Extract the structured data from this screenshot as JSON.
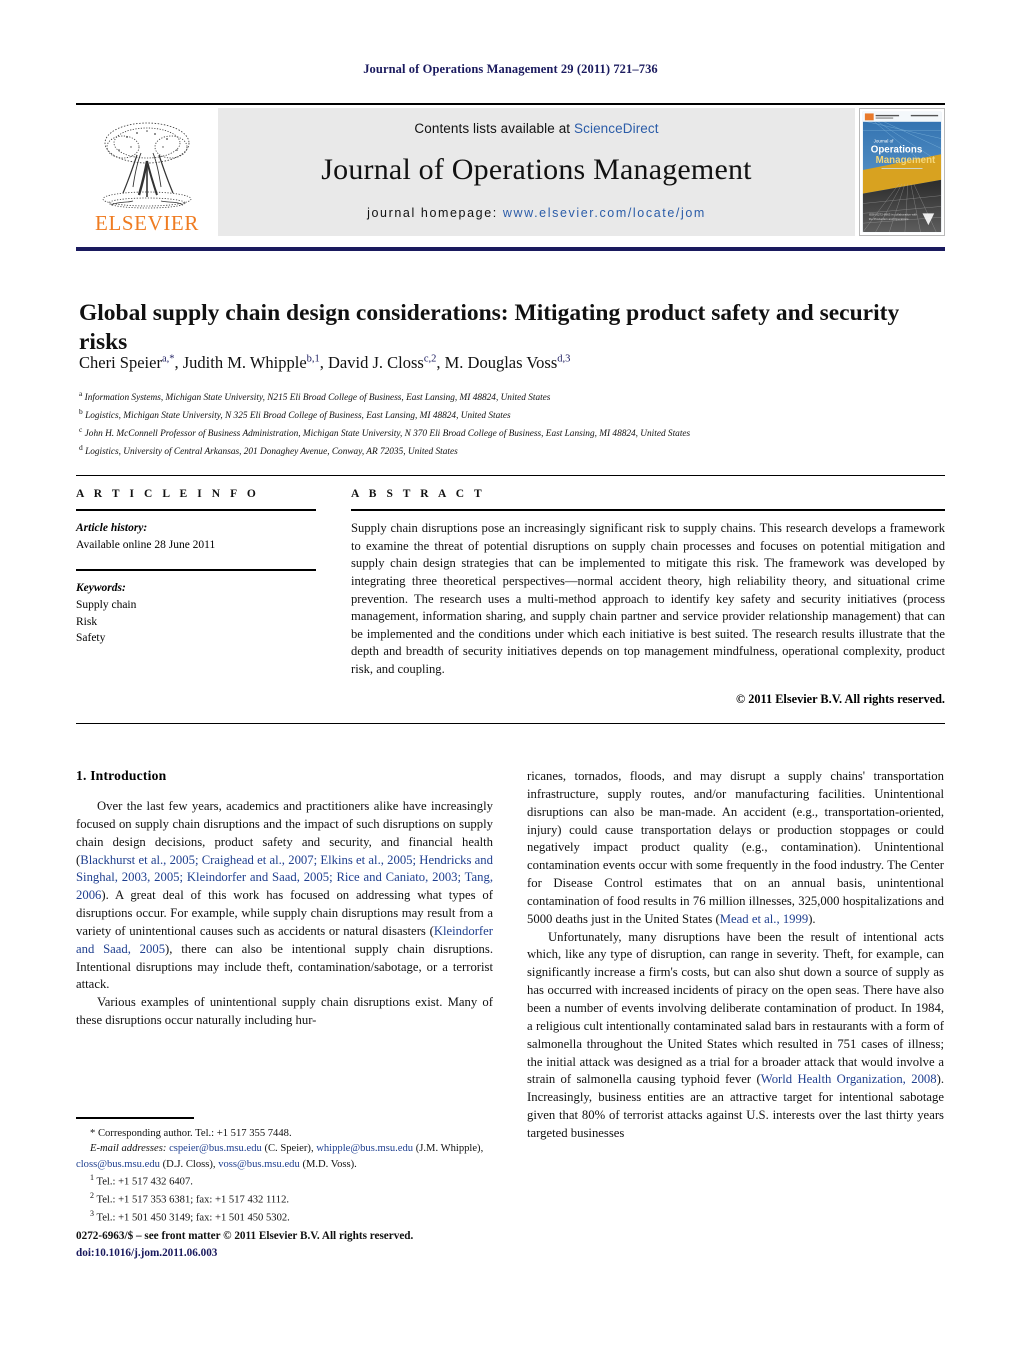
{
  "running_head": "Journal of Operations Management 29 (2011) 721–736",
  "masthead": {
    "publisher_logo_name": "elsevier-tree-logo",
    "publisher_name": "ELSEVIER",
    "contents_prefix": "Contents lists available at ",
    "contents_link": "ScienceDirect",
    "journal_title": "Journal of Operations Management",
    "homepage_prefix": "journal homepage: ",
    "homepage_url": "www.elsevier.com/locate/jom",
    "cover_line1": "Journal of",
    "cover_line2": "Operations",
    "cover_line3": "Management"
  },
  "article": {
    "title": "Global supply chain design considerations: Mitigating product safety and security risks",
    "authors_html": "Cheri Speier<sup>a,*</sup>, Judith M. Whipple<sup>b,1</sup>, David J. Closs<sup>c,2</sup>, M. Douglas Voss<sup>d,3</sup>",
    "affiliations": [
      {
        "marker": "a",
        "text": "Information Systems, Michigan State University, N215 Eli Broad College of Business, East Lansing, MI 48824, United States"
      },
      {
        "marker": "b",
        "text": "Logistics, Michigan State University, N 325 Eli Broad College of Business, East Lansing, MI 48824, United States"
      },
      {
        "marker": "c",
        "text": "John H. McConnell Professor of Business Administration, Michigan State University, N 370 Eli Broad College of Business, East Lansing, MI 48824, United States"
      },
      {
        "marker": "d",
        "text": "Logistics, University of Central Arkansas, 201 Donaghey Avenue, Conway, AR 72035, United States"
      }
    ]
  },
  "article_info": {
    "heading": "A R T I C L E    I N F O",
    "history_label": "Article history:",
    "history_value": "Available online 28 June 2011",
    "keywords_label": "Keywords:",
    "keywords": [
      "Supply chain",
      "Risk",
      "Safety"
    ]
  },
  "abstract": {
    "heading": "A B S T R A C T",
    "text": "Supply chain disruptions pose an increasingly significant risk to supply chains. This research develops a framework to examine the threat of potential disruptions on supply chain processes and focuses on potential mitigation and supply chain design strategies that can be implemented to mitigate this risk. The framework was developed by integrating three theoretical perspectives—normal accident theory, high reliability theory, and situational crime prevention. The research uses a multi-method approach to identify key safety and security initiatives (process management, information sharing, and supply chain partner and service provider relationship management) that can be implemented and the conditions under which each initiative is best suited. The research results illustrate that the depth and breadth of security initiatives depends on top management mindfulness, operational complexity, product risk, and coupling.",
    "copyright": "© 2011 Elsevier B.V. All rights reserved."
  },
  "body": {
    "section_number_title": "1.  Introduction",
    "left_paragraphs": [
      "Over the last few years, academics and practitioners alike have increasingly focused on supply chain disruptions and the impact of such disruptions on supply chain design decisions, product safety and security, and financial health (Blackhurst et al., 2005; Craighead et al., 2007; Elkins et al., 2005; Hendricks and Singhal, 2003, 2005; Kleindorfer and Saad, 2005; Rice and Caniato, 2003; Tang, 2006). A great deal of this work has focused on addressing what types of disruptions occur. For example, while supply chain disruptions may result from a variety of unintentional causes such as accidents or natural disasters (Kleindorfer and Saad, 2005), there can also be intentional supply chain disruptions. Intentional disruptions may include theft, contamination/sabotage, or a terrorist attack.",
      "Various examples of unintentional supply chain disruptions exist. Many of these disruptions occur naturally including hur-"
    ],
    "right_paragraphs": [
      "ricanes, tornados, floods, and may disrupt a supply chains' transportation infrastructure, supply routes, and/or manufacturing facilities. Unintentional disruptions can also be man-made. An accident (e.g., transportation-oriented, injury) could cause transportation delays or production stoppages or could negatively impact product quality (e.g., contamination). Unintentional contamination events occur with some frequently in the food industry. The Center for Disease Control estimates that on an annual basis, unintentional contamination of food results in 76 million illnesses, 325,000 hospitalizations and 5000 deaths just in the United States (Mead et al., 1999).",
      "Unfortunately, many disruptions have been the result of intentional acts which, like any type of disruption, can range in severity. Theft, for example, can significantly increase a firm's costs, but can also shut down a source of supply as has occurred with increased incidents of piracy on the open seas. There have also been a number of events involving deliberate contamination of product. In 1984, a religious cult intentionally contaminated salad bars in restaurants with a form of salmonella throughout the United States which resulted in 751 cases of illness; the initial attack was designed as a trial for a broader attack that would involve a strain of salmonella causing typhoid fever (World Health Organization, 2008). Increasingly, business entities are an attractive target for intentional sabotage given that 80% of terrorist attacks against U.S. interests over the last thirty years targeted businesses"
    ]
  },
  "footnotes": {
    "corresponding": "* Corresponding author. Tel.: +1 517 355 7448.",
    "email_label": "E-mail addresses:",
    "emails": [
      {
        "address": "cspeier@bus.msu.edu",
        "person": "(C. Speier)"
      },
      {
        "address": "whipple@bus.msu.edu",
        "person": "(J.M. Whipple)"
      },
      {
        "address": "closs@bus.msu.edu",
        "person": "(D.J. Closs)"
      },
      {
        "address": "voss@bus.msu.edu",
        "person": "(M.D. Voss)."
      }
    ],
    "numbered": [
      {
        "num": "1",
        "text": "Tel.: +1 517 432 6407."
      },
      {
        "num": "2",
        "text": "Tel.: +1 517 353 6381; fax: +1 517 432 1112."
      },
      {
        "num": "3",
        "text": "Tel.: +1 501 450 3149; fax: +1 501 450 5302."
      }
    ]
  },
  "imprint": {
    "issn_line": "0272-6963/$ – see front matter © 2011 Elsevier B.V. All rights reserved.",
    "doi_line": "doi:10.1016/j.jom.2011.06.003"
  },
  "colors": {
    "link_blue": "#2b5ca8",
    "ref_blue": "#1f3f8f",
    "navy_rule": "#1a1a5e",
    "elsevier_orange": "#ef7c22",
    "band_gray": "#e9e9e9"
  }
}
